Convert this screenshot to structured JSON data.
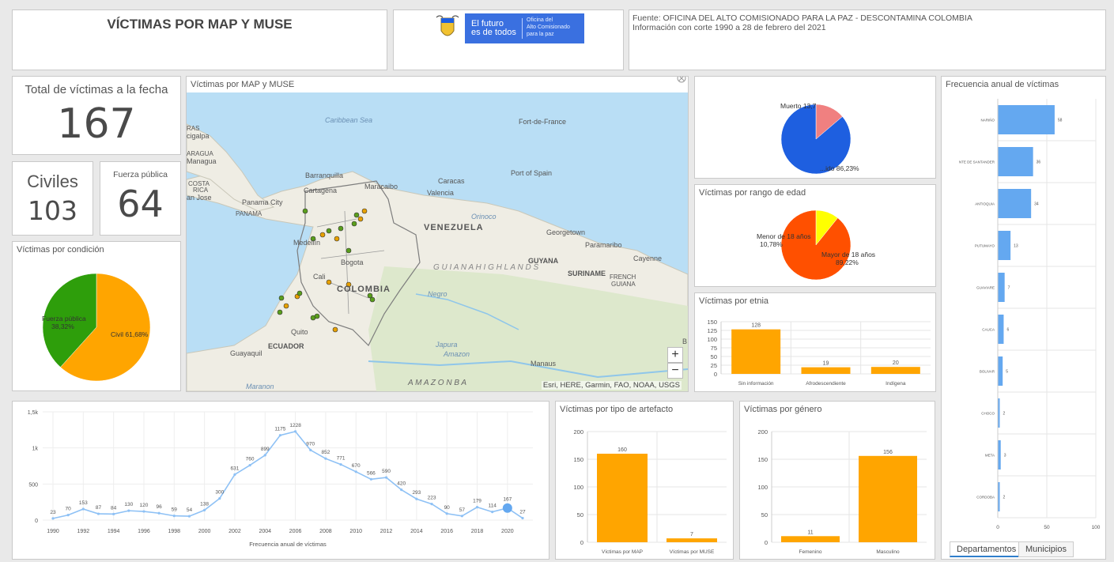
{
  "header": {
    "title": "VÍCTIMAS POR MAP Y MUSE",
    "logo_line1": "El futuro",
    "logo_line2": "es de todos",
    "logo_sub1": "Oficina del",
    "logo_sub2": "Alto Comisionado",
    "logo_sub3": "para la paz",
    "source_line1": "Fuente: OFICINA DEL ALTO COMISIONADO PARA LA PAZ - DESCONTAMINA COLOMBIA",
    "source_line2": "Información con corte 1990 a 28 de febrero del 2021"
  },
  "total": {
    "label": "Total de víctimas a la fecha",
    "value": "167"
  },
  "civiles": {
    "label": "Civiles",
    "value": "103"
  },
  "fuerza": {
    "label": "Fuerza pública",
    "value": "64"
  },
  "colors": {
    "orange": "#FFA500",
    "green": "#2E9E0B",
    "blue": "#1E5FE0",
    "salmon": "#F08080",
    "red": "#FF5000",
    "yellow": "#FFFF00",
    "lightblue": "#64A8F0",
    "mapWater": "#B9DEF5",
    "mapLand": "#EFEDE4"
  },
  "map": {
    "title": "Víctimas por MAP y MUSE",
    "attribution": "Esri, HERE, Garmin, FAO, NOAA, USGS",
    "zoom_in": "+",
    "zoom_out": "−",
    "labels": {
      "caribbean": "Caribbean Sea",
      "fort": "Fort-de-France",
      "port": "Port of Spain",
      "barranquilla": "Barranquilla",
      "cartagena": "Cartagena",
      "maracaibo": "Maracaibo",
      "caracas": "Caracas",
      "valencia": "Valencia",
      "panama_city": "Panama City",
      "panama": "PANAMA",
      "costa": "COSTA",
      "rica": "RICA",
      "jose": "an Jose",
      "managua": "Managua",
      "aragua": "ARAGUA",
      "ras": "RAS",
      "cigalpa": "cigalpa",
      "venezuela": "VENEZUELA",
      "georgetown": "Georgetown",
      "paramaribo": "Paramaribo",
      "cayenne": "Cayenne",
      "guyana": "GUYANA",
      "suriname": "SURINAME",
      "french": "FRENCH",
      "guiana": "GUIANA",
      "guiana_hl": "G U I A N A   H I G H L A N D S",
      "medellin": "Medellín",
      "bogota": "Bogota",
      "cali": "Cali",
      "colombia": "COLOMBIA",
      "quito": "Quito",
      "ecuador": "ECUADOR",
      "guayaquil": "Guayaquil",
      "manaus": "Manaus",
      "amazon": "A M A Z O N   B A",
      "amazon_river": "Amazon",
      "japura": "Japura",
      "negro": "Negro",
      "maranon": "Maranon",
      "orinoco": "Orinoco",
      "b": "B"
    }
  },
  "condicion": {
    "title": "Víctimas por condición"
  },
  "estado": {
    "title": ""
  },
  "edad": {
    "title": "Víctimas por rango de edad"
  },
  "etnia": {
    "title": "Víctimas por etnia"
  },
  "artefacto": {
    "title": "Víctimas por tipo de artefacto"
  },
  "genero": {
    "title": "Víctimas por género"
  },
  "depto": {
    "title": "Frecuencia anual de víctimas"
  },
  "tabs": {
    "departamentos": "Departamentos",
    "municipios": "Municipios"
  },
  "chart_data": [
    {
      "id": "condicion",
      "type": "pie",
      "labels": [
        "Civil 61,68%",
        "Fuerza pública 38,32%"
      ],
      "values": [
        61.68,
        38.32
      ],
      "colors": [
        "#FFA500",
        "#2E9E0B"
      ]
    },
    {
      "id": "estado",
      "type": "pie",
      "labels": [
        "Muerto 13,7",
        "...ido 86,23%"
      ],
      "values": [
        13.77,
        86.23
      ],
      "colors": [
        "#F08080",
        "#1E5FE0"
      ]
    },
    {
      "id": "edad",
      "type": "pie",
      "labels": [
        "Menor de 18 años 10,78%",
        "Mayor de 18 años 89,22%"
      ],
      "values": [
        10.78,
        89.22
      ],
      "colors": [
        "#FFFF00",
        "#FF5000"
      ]
    },
    {
      "id": "etnia",
      "type": "bar",
      "categories": [
        "Sin información",
        "Afrodescendiente",
        "Indígena"
      ],
      "values": [
        128,
        19,
        20
      ],
      "yticks": [
        "0",
        "25",
        "50",
        "75",
        "100",
        "125",
        "150"
      ],
      "ylim": [
        0,
        150
      ]
    },
    {
      "id": "anual",
      "type": "line",
      "x": [
        1990,
        1991,
        1992,
        1993,
        1994,
        1995,
        1996,
        1997,
        1998,
        1999,
        2000,
        2001,
        2002,
        2003,
        2004,
        2005,
        2006,
        2007,
        2008,
        2009,
        2010,
        2011,
        2012,
        2013,
        2014,
        2015,
        2016,
        2017,
        2018,
        2019,
        2020,
        2021
      ],
      "values": [
        23,
        70,
        153,
        87,
        84,
        130,
        120,
        96,
        59,
        54,
        138,
        300,
        631,
        760,
        899,
        1175,
        1228,
        970,
        852,
        771,
        670,
        566,
        590,
        420,
        293,
        223,
        90,
        57,
        179,
        114,
        167,
        27
      ],
      "xticks": [
        "1990",
        "1992",
        "1994",
        "1996",
        "1998",
        "2000",
        "2002",
        "2004",
        "2006",
        "2008",
        "2010",
        "2012",
        "2014",
        "2016",
        "2018",
        "2020"
      ],
      "yticks": [
        "0",
        "500",
        "1k",
        "1,5k"
      ],
      "xlabel": "Frecuencia anual de víctimas",
      "ylim": [
        0,
        1500
      ],
      "highlight": 2020
    },
    {
      "id": "artefacto",
      "type": "bar",
      "categories": [
        "Víctimas por MAP",
        "Víctimas por MUSE"
      ],
      "values": [
        160,
        7
      ],
      "yticks": [
        "0",
        "50",
        "100",
        "150",
        "200"
      ],
      "ylim": [
        0,
        200
      ]
    },
    {
      "id": "genero",
      "type": "bar",
      "categories": [
        "Femenino",
        "Masculino"
      ],
      "values": [
        11,
        156
      ],
      "yticks": [
        "0",
        "50",
        "100",
        "150",
        "200"
      ],
      "ylim": [
        0,
        200
      ]
    },
    {
      "id": "depto",
      "type": "bar",
      "orientation": "horizontal",
      "categories": [
        "NARIÑO",
        "NTE DE SANTANDER",
        "ANTIOQUIA",
        "PUTUMAYO",
        "GUAVIARE",
        "CAUCA",
        "BOLIVAR",
        "CHOCO",
        "META",
        "CORDOBA"
      ],
      "values": [
        58,
        36,
        34,
        13,
        7,
        6,
        5,
        2,
        3,
        2
      ],
      "xticks": [
        "0",
        "50",
        "100"
      ],
      "xlim": [
        0,
        100
      ]
    }
  ]
}
